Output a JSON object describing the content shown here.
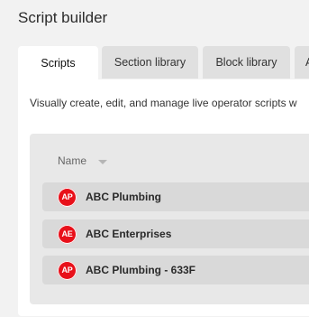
{
  "header": {
    "title": "Script builder"
  },
  "tabs": [
    {
      "label": "Scripts",
      "active": true
    },
    {
      "label": "Section library",
      "active": false
    },
    {
      "label": "Block library",
      "active": false
    },
    {
      "label": "A",
      "active": false
    }
  ],
  "description": "Visually create, edit, and manage live operator scripts w",
  "table": {
    "column_header": "Name",
    "sort_icon": "caret-down-icon",
    "rows": [
      {
        "avatar": "AP",
        "name": "ABC Plumbing"
      },
      {
        "avatar": "AE",
        "name": "ABC Enterprises"
      },
      {
        "avatar": "AP",
        "name": "ABC Plumbing - 633F"
      }
    ]
  },
  "colors": {
    "background": "#f2f2f2",
    "panel": "#ffffff",
    "tab_inactive": "#e0e0e0",
    "list_background": "#e8e8e8",
    "row_background": "#d9d9d9",
    "avatar": "#e8101a"
  }
}
